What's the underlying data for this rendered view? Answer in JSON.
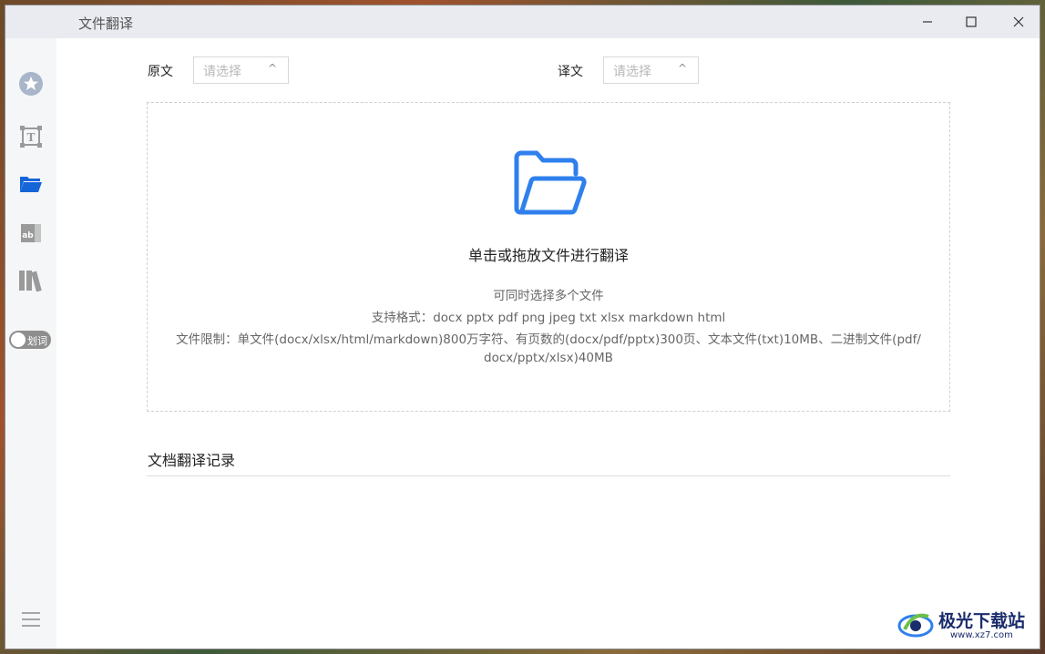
{
  "window": {
    "title": "文件翻译",
    "controls": {
      "minimize": "—",
      "maximize": "☐",
      "close": "✕"
    }
  },
  "sidebar": {
    "items": [
      {
        "name": "favorites",
        "icon": "star-badge-icon",
        "active": false
      },
      {
        "name": "text-translate",
        "icon": "text-frame-icon",
        "active": false
      },
      {
        "name": "file-translate",
        "icon": "folder-open-icon",
        "active": true
      },
      {
        "name": "image-translate",
        "icon": "ab-image-icon",
        "active": false
      },
      {
        "name": "library",
        "icon": "books-icon",
        "active": false
      }
    ],
    "toggle": {
      "label": "划词",
      "on": false
    },
    "menu_icon": "hamburger-icon"
  },
  "source": {
    "label": "原文",
    "placeholder": "请选择"
  },
  "target": {
    "label": "译文",
    "placeholder": "请选择"
  },
  "dropzone": {
    "title": "单击或拖放文件进行翻译",
    "line1": "可同时选择多个文件",
    "line2": "支持格式：docx pptx pdf png jpeg txt xlsx markdown html",
    "line3": "文件限制：单文件(docx/xlsx/html/markdown)800万字符、有页数的(docx/pdf/pptx)300页、文本文件(txt)10MB、二进制文件(pdf/",
    "line4": "docx/pptx/xlsx)40MB"
  },
  "history": {
    "title": "文档翻译记录"
  },
  "watermark": {
    "text": "极光下载站",
    "url": "www.xz7.com"
  },
  "colors": {
    "accent": "#2f80ed",
    "sidebar_icon": "#9a9a9a",
    "active_icon": "#1565d8"
  }
}
